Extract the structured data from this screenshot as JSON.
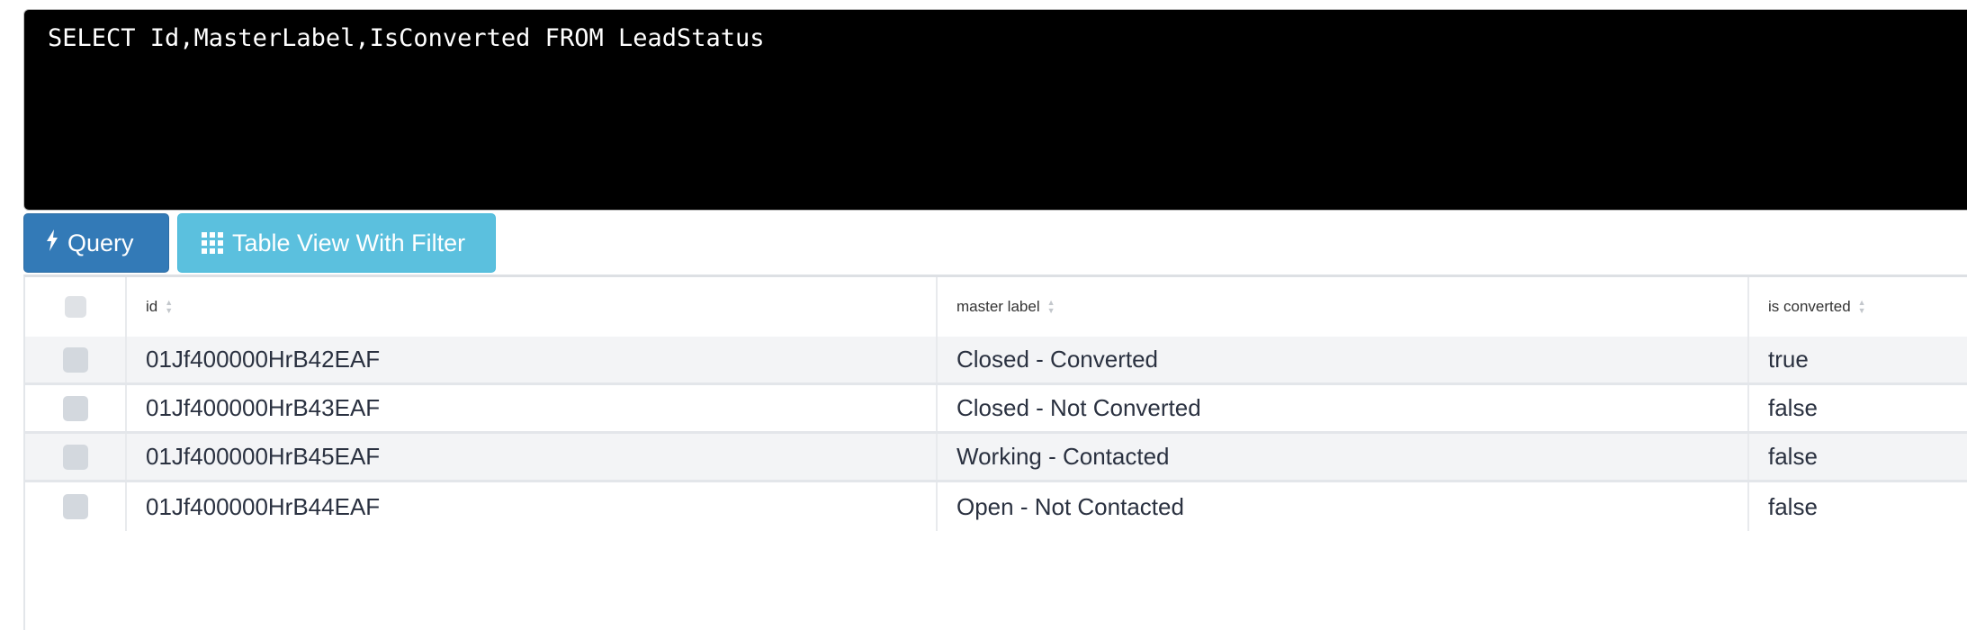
{
  "editor": {
    "query": "SELECT Id,MasterLabel,IsConverted FROM LeadStatus"
  },
  "toolbar": {
    "query_label": "Query",
    "table_view_label": "Table View With Filter"
  },
  "table": {
    "columns": [
      "id",
      "master label",
      "is converted"
    ],
    "rows": [
      {
        "id": "01Jf400000HrB42EAF",
        "master_label": "Closed - Converted",
        "is_converted": "true"
      },
      {
        "id": "01Jf400000HrB43EAF",
        "master_label": "Closed - Not Converted",
        "is_converted": "false"
      },
      {
        "id": "01Jf400000HrB45EAF",
        "master_label": "Working - Contacted",
        "is_converted": "false"
      },
      {
        "id": "01Jf400000HrB44EAF",
        "master_label": "Open - Not Contacted",
        "is_converted": "false"
      }
    ]
  }
}
